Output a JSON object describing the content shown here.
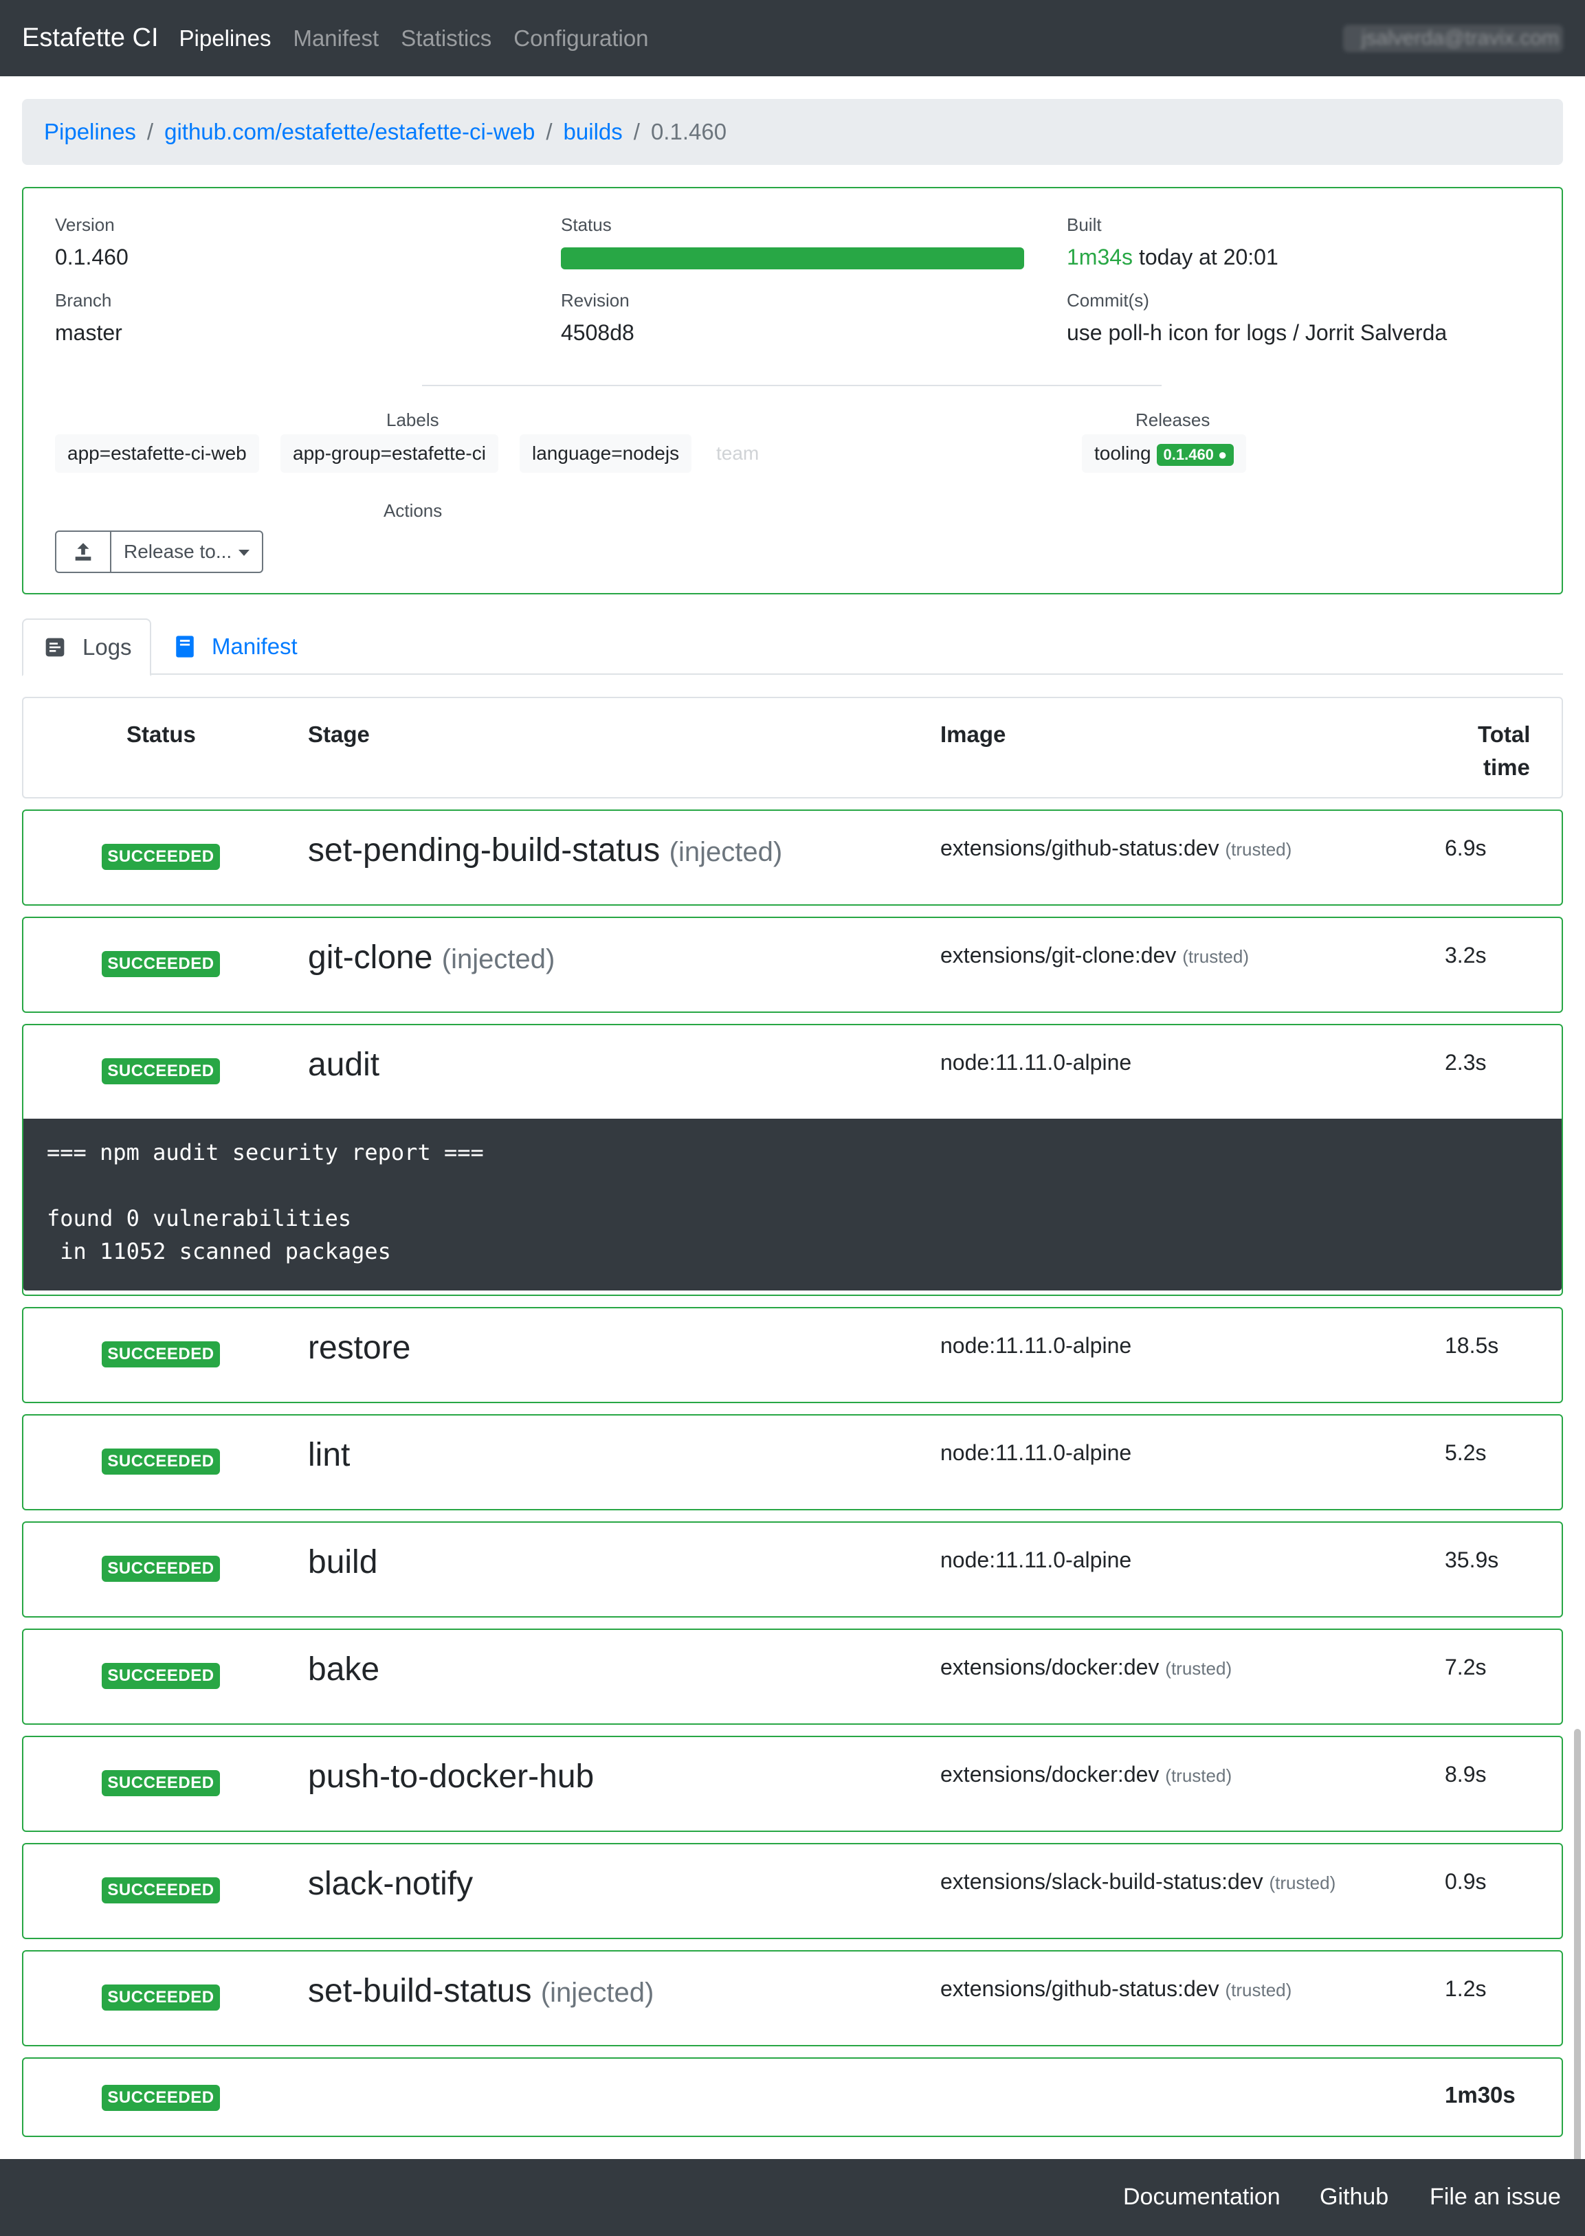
{
  "navbar": {
    "brand": "Estafette CI",
    "items": [
      {
        "label": "Pipelines",
        "active": true
      },
      {
        "label": "Manifest",
        "active": false
      },
      {
        "label": "Statistics",
        "active": false
      },
      {
        "label": "Configuration",
        "active": false
      }
    ],
    "user": "jsalverda@travix.com"
  },
  "breadcrumb": {
    "items": [
      "Pipelines",
      "github.com/estafette/estafette-ci-web",
      "builds"
    ],
    "current": "0.1.460"
  },
  "build": {
    "version_label": "Version",
    "version": "0.1.460",
    "status_label": "Status",
    "status_progress": 1.0,
    "built_label": "Built",
    "built_duration": "1m34s",
    "built_time": "today at 20:01",
    "branch_label": "Branch",
    "branch": "master",
    "revision_label": "Revision",
    "revision": "4508d8",
    "commits_label": "Commit(s)",
    "commits": "use poll-h icon for logs / Jorrit Salverda",
    "labels_label": "Labels",
    "labels": [
      "app=estafette-ci-web",
      "app-group=estafette-ci",
      "language=nodejs",
      "team"
    ],
    "releases_label": "Releases",
    "release_name": "tooling",
    "release_version": "0.1.460",
    "actions_label": "Actions",
    "release_to": "Release to..."
  },
  "tabs": {
    "logs": "Logs",
    "manifest": "Manifest"
  },
  "table": {
    "headers": {
      "status": "Status",
      "stage": "Stage",
      "image": "Image",
      "total_line1": "Total",
      "total_line2": "time"
    },
    "rows": [
      {
        "status": "SUCCEEDED",
        "stage": "set-pending-build-status",
        "injected": "(injected)",
        "image": "extensions/github-status:dev",
        "trusted": "(trusted)",
        "time": "6.9s"
      },
      {
        "status": "SUCCEEDED",
        "stage": "git-clone",
        "injected": "(injected)",
        "image": "extensions/git-clone:dev",
        "trusted": "(trusted)",
        "time": "3.2s"
      },
      {
        "status": "SUCCEEDED",
        "stage": "audit",
        "injected": "",
        "image": "node:11.11.0-alpine",
        "trusted": "",
        "time": "2.3s"
      },
      {
        "status": "SUCCEEDED",
        "stage": "restore",
        "injected": "",
        "image": "node:11.11.0-alpine",
        "trusted": "",
        "time": "18.5s"
      },
      {
        "status": "SUCCEEDED",
        "stage": "lint",
        "injected": "",
        "image": "node:11.11.0-alpine",
        "trusted": "",
        "time": "5.2s"
      },
      {
        "status": "SUCCEEDED",
        "stage": "build",
        "injected": "",
        "image": "node:11.11.0-alpine",
        "trusted": "",
        "time": "35.9s"
      },
      {
        "status": "SUCCEEDED",
        "stage": "bake",
        "injected": "",
        "image": "extensions/docker:dev",
        "trusted": "(trusted)",
        "time": "7.2s"
      },
      {
        "status": "SUCCEEDED",
        "stage": "push-to-docker-hub",
        "injected": "",
        "image": "extensions/docker:dev",
        "trusted": "(trusted)",
        "time": "8.9s"
      },
      {
        "status": "SUCCEEDED",
        "stage": "slack-notify",
        "injected": "",
        "image": "extensions/slack-build-status:dev",
        "trusted": "(trusted)",
        "time": "0.9s"
      },
      {
        "status": "SUCCEEDED",
        "stage": "set-build-status",
        "injected": "(injected)",
        "image": "extensions/github-status:dev",
        "trusted": "(trusted)",
        "time": "1.2s"
      }
    ],
    "audit_log": [
      "=== npm audit security report ===",
      "found 0 vulnerabilities",
      " in 11052 scanned packages"
    ],
    "summary": {
      "status": "SUCCEEDED",
      "total": "1m30s"
    }
  },
  "footer": {
    "links": [
      "Documentation",
      "Github",
      "File an issue"
    ]
  },
  "colors": {
    "success": "#28a745",
    "link": "#007bff",
    "dark": "#343a40"
  }
}
